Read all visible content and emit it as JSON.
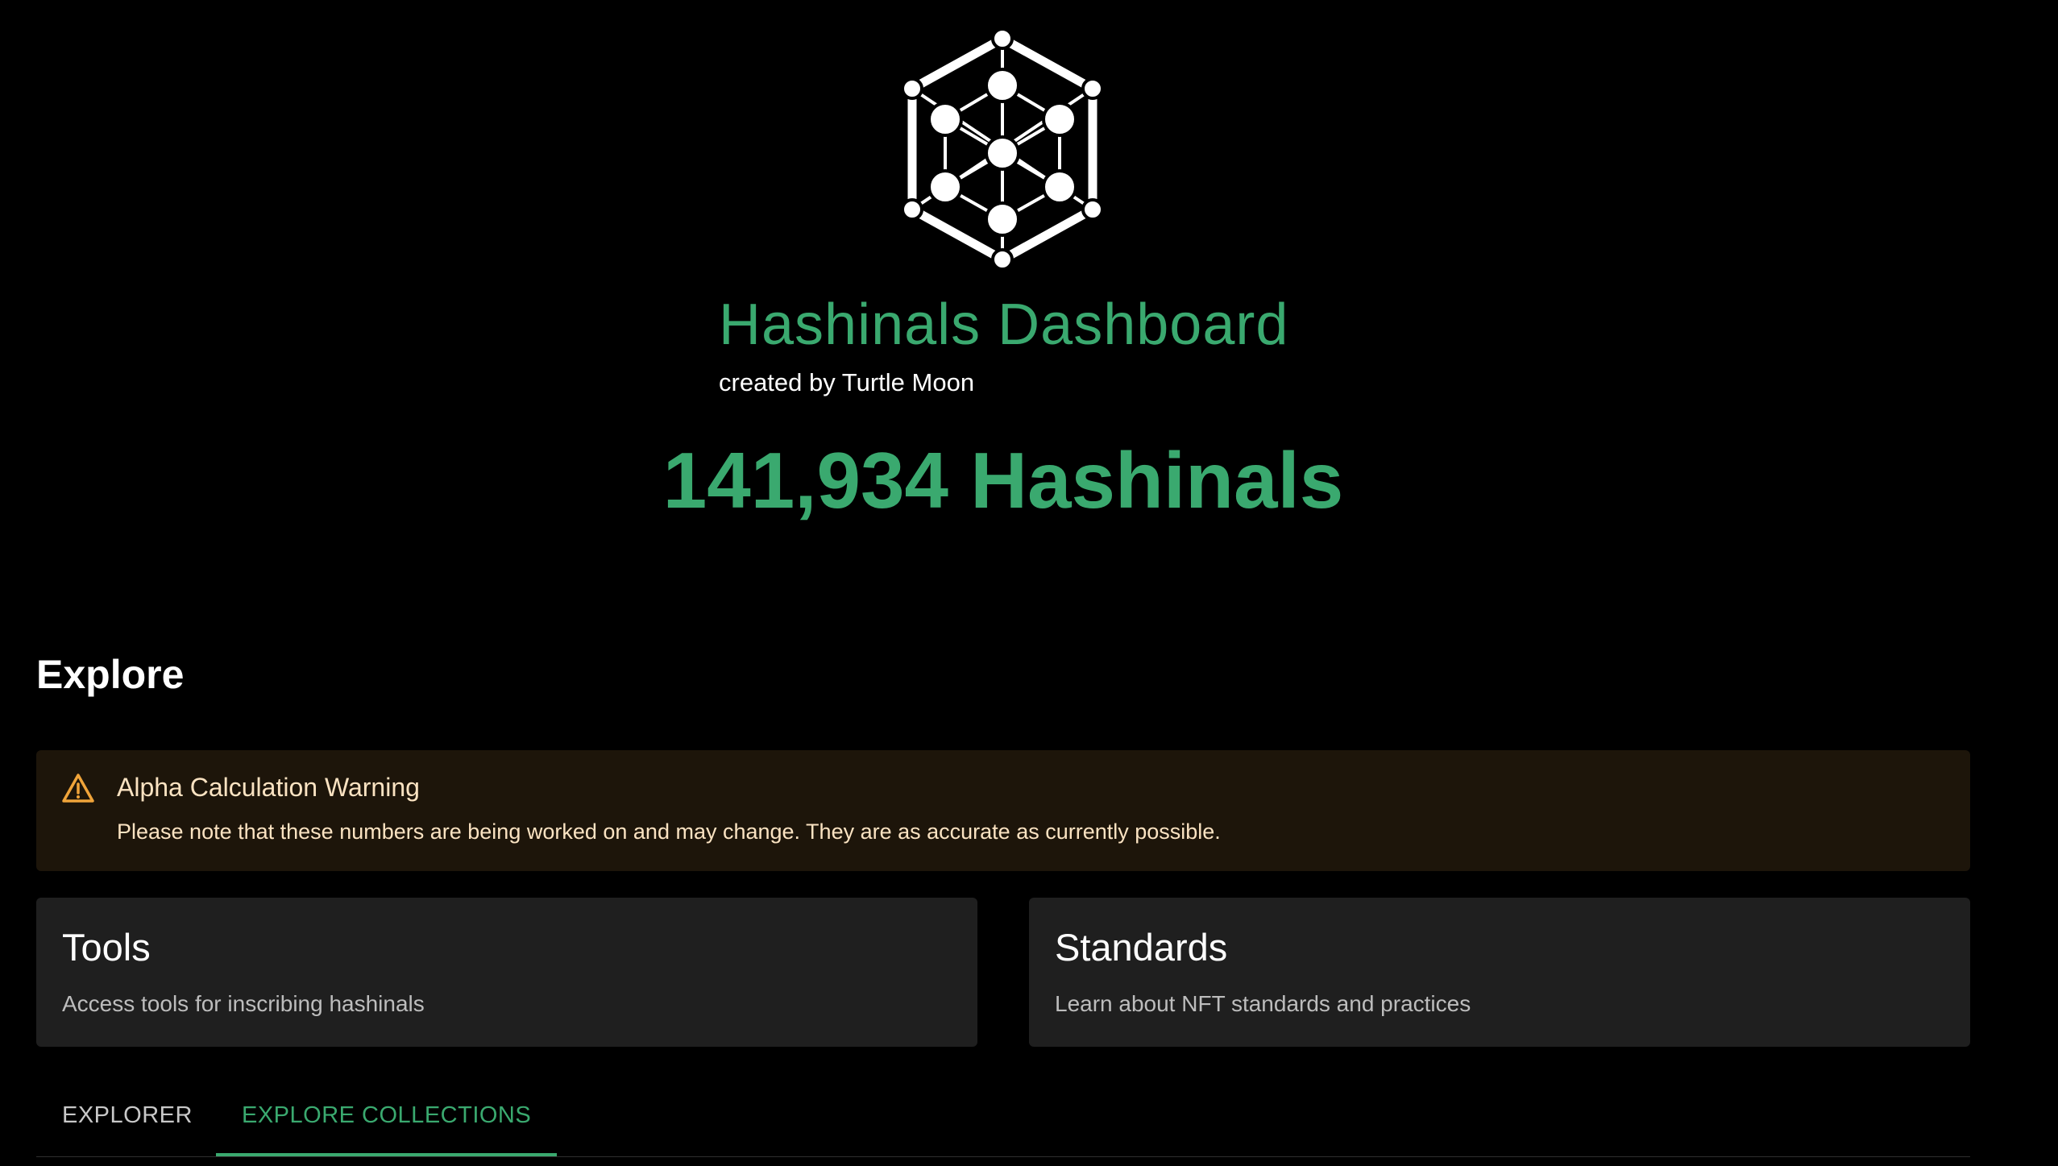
{
  "header": {
    "logo_icon": "hexagon-network-logo-icon",
    "title": "Hashinals Dashboard",
    "subtitle": "created by Turtle Moon",
    "count": "141,934 Hashinals"
  },
  "explore": {
    "heading": "Explore"
  },
  "alert": {
    "icon": "warning-triangle-icon",
    "title": "Alpha Calculation Warning",
    "text": "Please note that these numbers are being worked on and may change. They are as accurate as currently possible."
  },
  "cards": [
    {
      "title": "Tools",
      "description": "Access tools for inscribing hashinals"
    },
    {
      "title": "Standards",
      "description": "Learn about NFT standards and practices"
    }
  ],
  "tabs": [
    {
      "label": "EXPLORER",
      "active": false
    },
    {
      "label": "EXPLORE COLLECTIONS",
      "active": true
    }
  ],
  "colors": {
    "accent": "#3aa96f",
    "background": "#000000",
    "card": "#1f1f1f",
    "alert_background": "#1d150a",
    "alert_icon": "#f0a43a",
    "alert_text": "#fbe3c2"
  }
}
